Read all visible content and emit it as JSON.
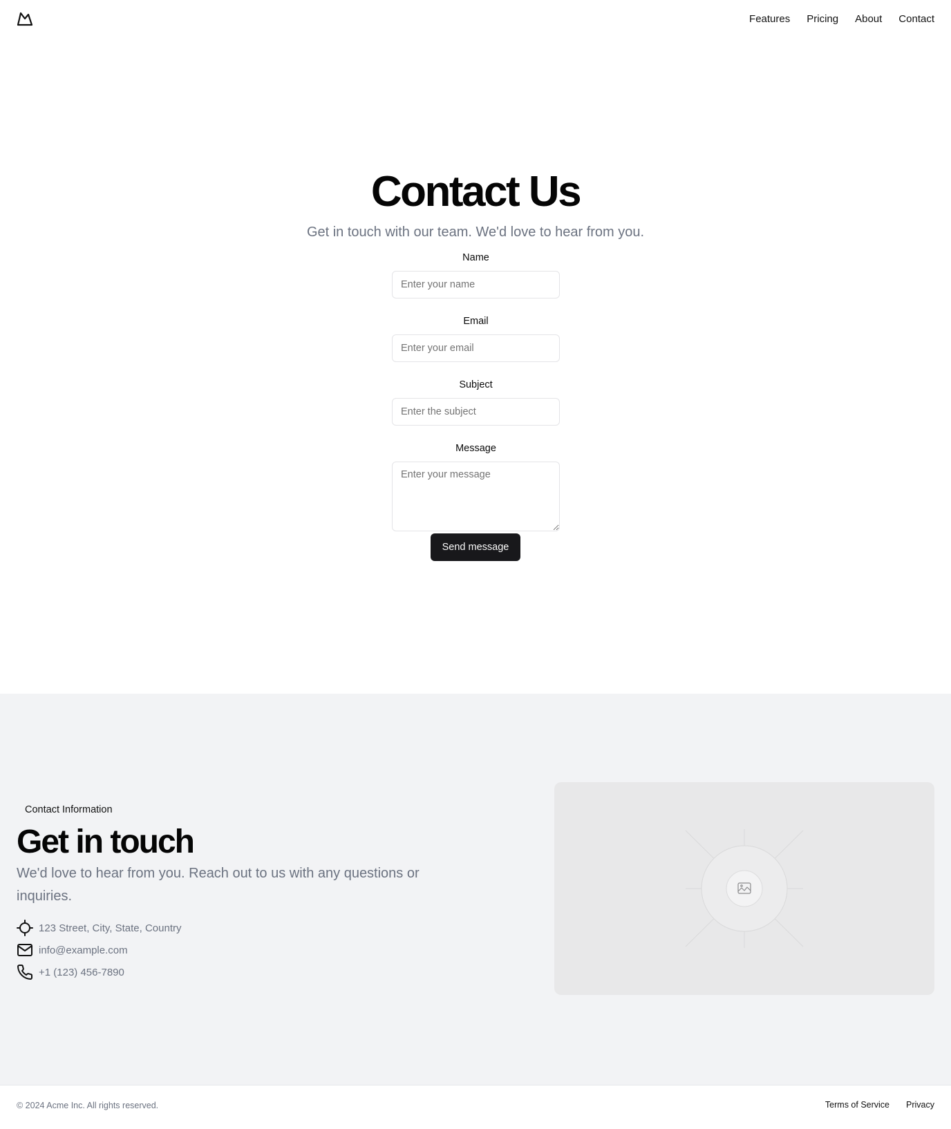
{
  "header": {
    "logo_icon": "mountain-logo-icon",
    "nav": [
      {
        "label": "Features"
      },
      {
        "label": "Pricing"
      },
      {
        "label": "About"
      },
      {
        "label": "Contact"
      }
    ]
  },
  "hero": {
    "title": "Contact Us",
    "subtitle": "Get in touch with our team. We'd love to hear from you."
  },
  "form": {
    "name": {
      "label": "Name",
      "placeholder": "Enter your name",
      "value": ""
    },
    "email": {
      "label": "Email",
      "placeholder": "Enter your email",
      "value": ""
    },
    "subject": {
      "label": "Subject",
      "placeholder": "Enter the subject",
      "value": ""
    },
    "message": {
      "label": "Message",
      "placeholder": "Enter your message",
      "value": ""
    },
    "submit_label": "Send message"
  },
  "info": {
    "tag": "Contact Information",
    "title": "Get in touch",
    "description": "We'd love to hear from you. Reach out to us with any questions or inquiries.",
    "items": [
      {
        "icon": "location-crosshair-icon",
        "text": "123 Street, City, State, Country"
      },
      {
        "icon": "mail-icon",
        "text": "info@example.com"
      },
      {
        "icon": "phone-icon",
        "text": "+1 (123) 456-7890"
      }
    ],
    "image_icon": "image-placeholder-icon"
  },
  "footer": {
    "copyright": "© 2024 Acme Inc. All rights reserved.",
    "links": [
      {
        "label": "Terms of Service"
      },
      {
        "label": "Privacy"
      }
    ]
  },
  "colors": {
    "primary_button": "#18181b",
    "muted_text": "#6b7280",
    "section_bg": "#f2f3f5"
  }
}
